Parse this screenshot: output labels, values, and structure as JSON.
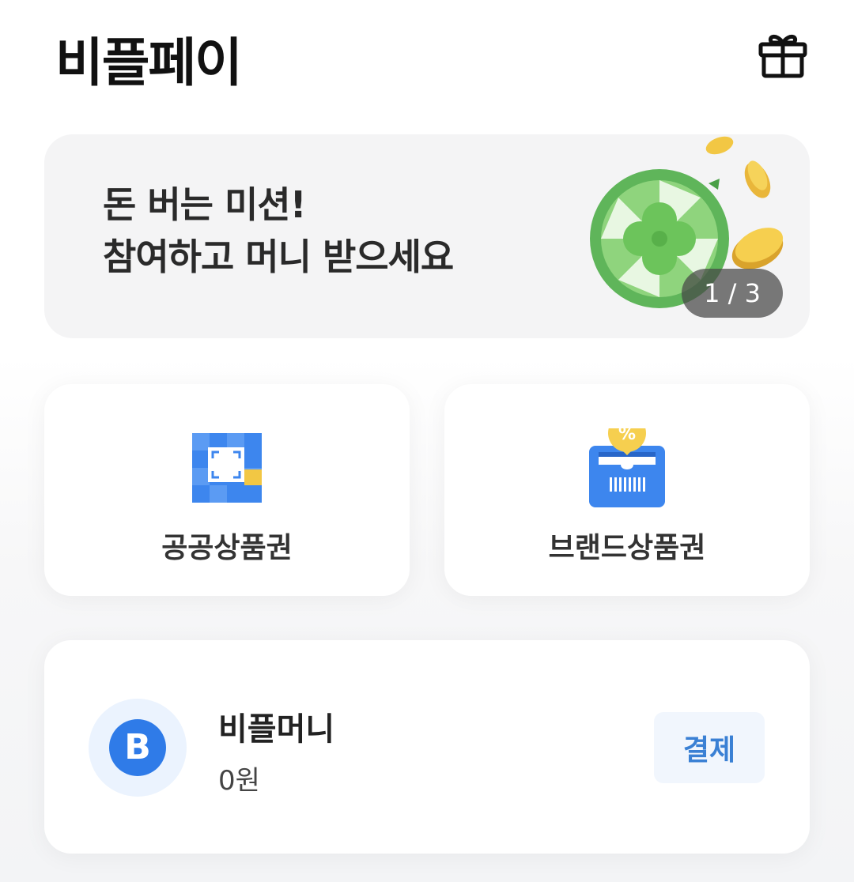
{
  "header": {
    "title": "비플페이",
    "gift_icon": "gift-icon"
  },
  "banner": {
    "line1": "돈 버는 미션!",
    "line2": "참여하고 머니 받으세요",
    "pager": "1 / 3",
    "image": "clover-roulette-with-coins"
  },
  "vouchers": [
    {
      "label": "공공상품권",
      "icon": "qr-scan-icon"
    },
    {
      "label": "브랜드상품권",
      "icon": "coupon-barcode-icon"
    }
  ],
  "money": {
    "avatar_letter": "B",
    "name": "비플머니",
    "balance": "0원",
    "pay_label": "결제"
  },
  "colors": {
    "accent_blue": "#2f7be8",
    "pay_text": "#3a80d4",
    "coin_gold": "#f2c744",
    "clover_green": "#6cc45b"
  }
}
